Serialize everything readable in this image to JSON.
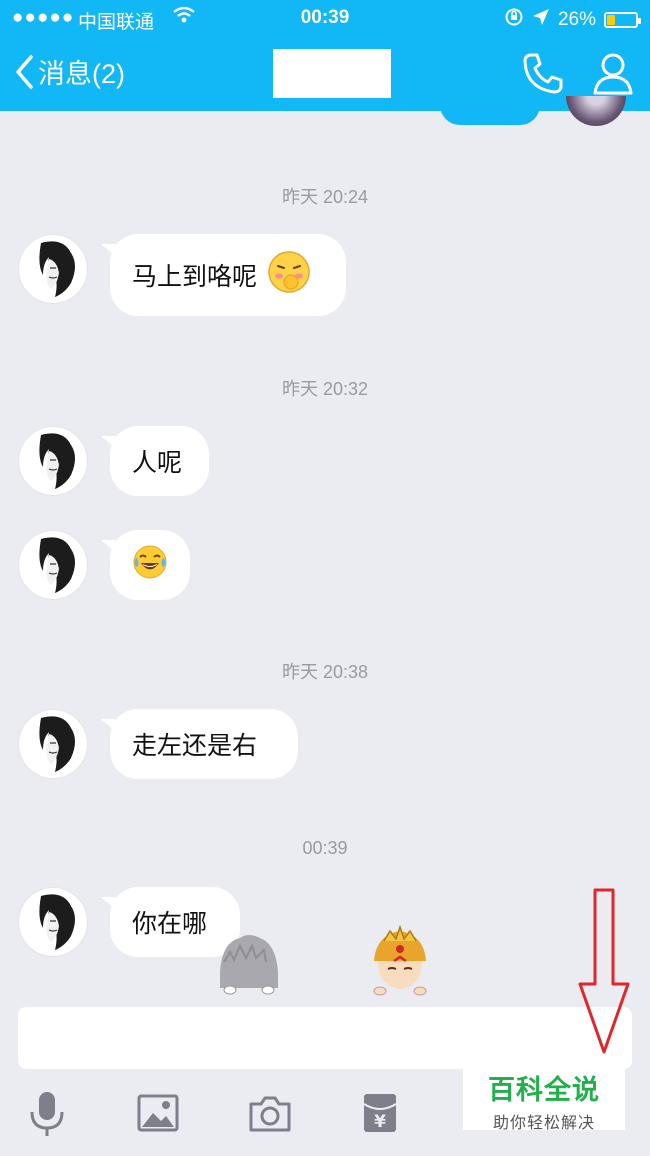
{
  "status_bar": {
    "signal": "●●●●●",
    "carrier": "中国联通",
    "time": "00:39",
    "battery": "26%",
    "battery_level": 0.26
  },
  "nav": {
    "back_label": "消息(2)"
  },
  "messages": [
    {
      "timestamp": "昨天 20:24",
      "text": "马上到咯呢"
    },
    {
      "timestamp": "昨天 20:32",
      "text": "人呢"
    },
    {
      "text": ""
    },
    {
      "timestamp": "昨天 20:38",
      "text": "走左还是右"
    },
    {
      "timestamp": "00:39",
      "text": "你在哪"
    }
  ],
  "input": {
    "placeholder": ""
  },
  "watermark": {
    "title": "百科全说",
    "subtitle": "助你轻松解决"
  },
  "colors": {
    "brand": "#12b7f5",
    "background": "#ebebf2",
    "annotation_arrow": "#e0262b",
    "watermark_green": "#21b04a"
  }
}
